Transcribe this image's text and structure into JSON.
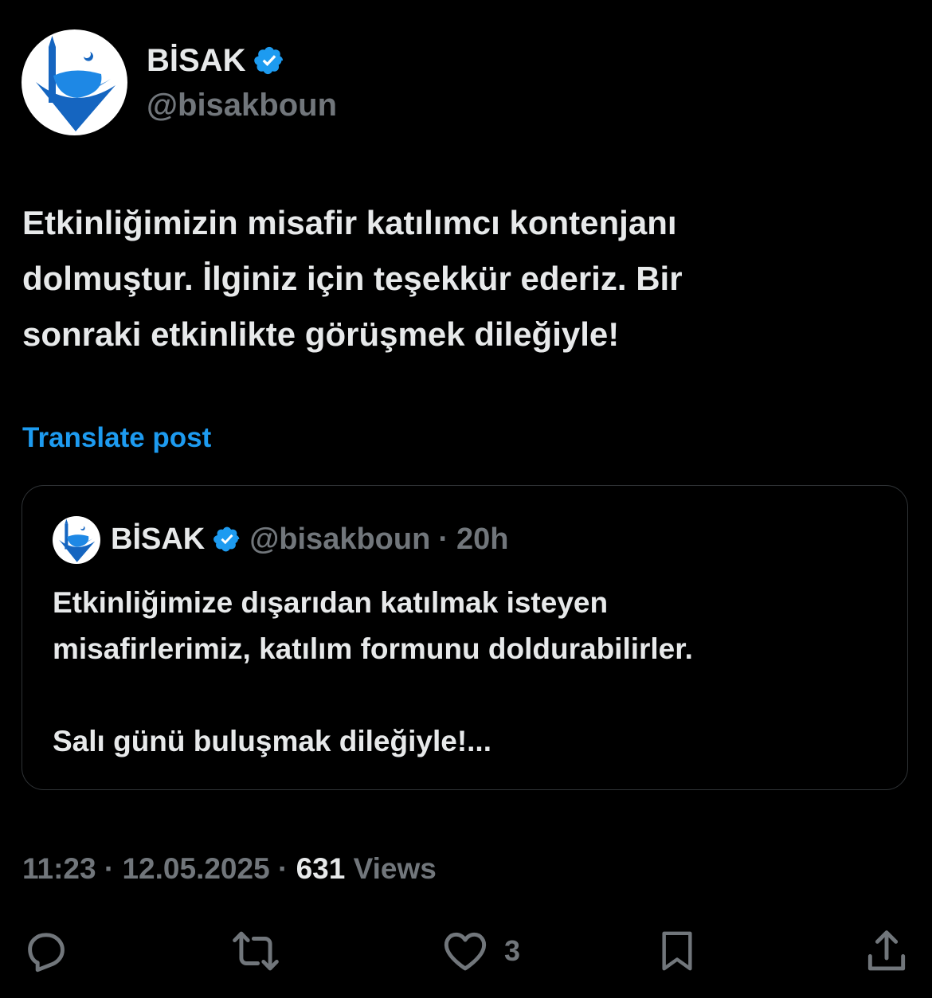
{
  "author": {
    "name": "BİSAK",
    "handle": "@bisakboun",
    "verified_color": "#1d9bf0"
  },
  "post": {
    "text": "Etkinliğimizin misafir katılımcı kontenjanı\ndolmuştur. İlginiz için teşekkür ederiz. Bir\nsonraki etkinlikte görüşmek dileğiyle!",
    "translate_label": "Translate post"
  },
  "quoted": {
    "name": "BİSAK",
    "handle": "@bisakboun",
    "separator": "·",
    "time": "20h",
    "text": "Etkinliğimize dışarıdan katılmak isteyen\nmisafirlerimiz, katılım formunu doldurabilirler.\n\nSalı günü buluşmak dileğiyle!..."
  },
  "meta": {
    "time": "11:23",
    "separator": "·",
    "date": "12.05.2025",
    "views_count": "631",
    "views_label": "Views"
  },
  "actions": {
    "reply_icon": "reply-icon",
    "repost_icon": "repost-icon",
    "like_icon": "heart-icon",
    "like_count": "3",
    "bookmark_icon": "bookmark-icon",
    "share_icon": "share-icon"
  },
  "colors": {
    "background": "#000000",
    "text": "#e7e9ea",
    "muted": "#71767b",
    "accent": "#1d9bf0",
    "logo_blue": "#1565c0"
  }
}
